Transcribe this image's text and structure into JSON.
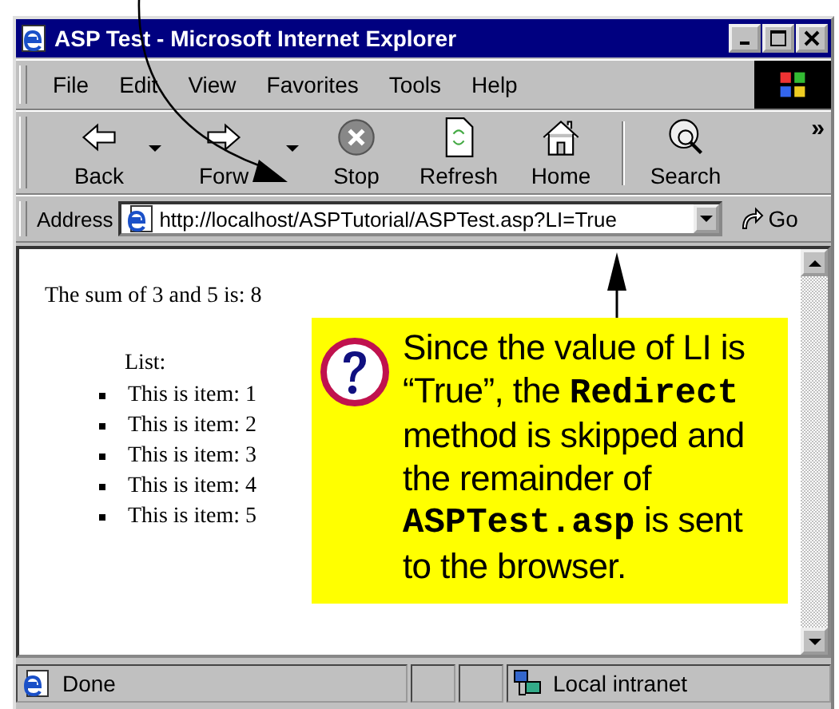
{
  "window": {
    "title": "ASP Test - Microsoft Internet Explorer"
  },
  "menu": [
    "File",
    "Edit",
    "View",
    "Favorites",
    "Tools",
    "Help"
  ],
  "toolbar": [
    {
      "label": "Back",
      "kind": "back",
      "dropdown": true
    },
    {
      "label": "Forw",
      "kind": "forward",
      "dropdown": true
    },
    {
      "label": "Stop",
      "kind": "stop",
      "dropdown": false
    },
    {
      "label": "Refresh",
      "kind": "refresh",
      "dropdown": false
    },
    {
      "label": "Home",
      "kind": "home",
      "dropdown": false
    },
    {
      "label": "Search",
      "kind": "search",
      "dropdown": false
    }
  ],
  "toolbar_more": "»",
  "address": {
    "label": "Address",
    "value": "http://localhost/ASPTutorial/ASPTest.asp?LI=True",
    "go": "Go"
  },
  "page": {
    "sum_text": "The sum of 3 and 5 is: 8",
    "list_heading": "List:",
    "items": [
      "This is item: 1",
      "This is item: 2",
      "This is item: 3",
      "This is item: 4",
      "This is item: 5"
    ]
  },
  "callout": {
    "segments": [
      {
        "kind": "plain",
        "text": "Since the value of LI is “True”, the "
      },
      {
        "kind": "code",
        "text": "Redirect"
      },
      {
        "kind": "plain",
        "text": " method is skipped and the remainder of "
      },
      {
        "kind": "code",
        "text": "ASPTest.asp"
      },
      {
        "kind": "plain",
        "text": " is sent to the browser."
      }
    ]
  },
  "status_bar": {
    "text": "Done",
    "zone": "Local intranet"
  }
}
